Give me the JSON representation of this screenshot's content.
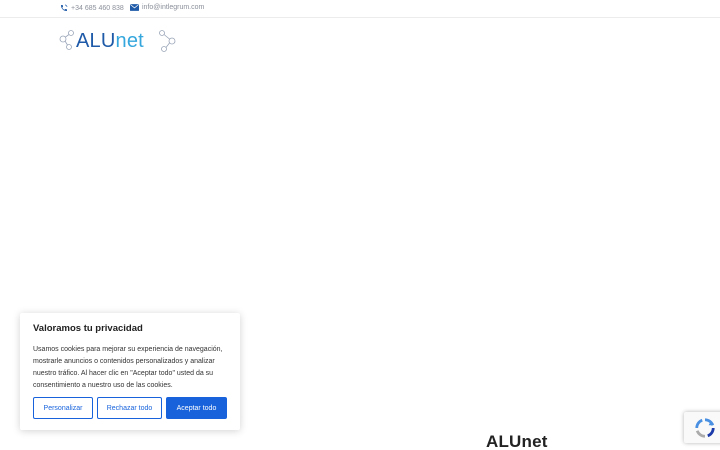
{
  "topbar": {
    "phone": "+34 685 460 838",
    "email": "info@intlegrum.com",
    "phone_icon": "phone-icon",
    "email_icon": "envelope-icon"
  },
  "logo": {
    "part1": "ALU",
    "part2": "net",
    "colors": {
      "alu": "#1e5aa8",
      "net": "#35a7dd"
    }
  },
  "cookie_banner": {
    "title": "Valoramos tu privacidad",
    "text": "Usamos cookies para mejorar su experiencia de navegación, mostrarle anuncios o contenidos personalizados y analizar nuestro tráfico. Al hacer clic en \"Aceptar todo\" usted da su consentimiento a nuestro uso de las cookies.",
    "customize_label": "Personalizar",
    "reject_label": "Rechazar todo",
    "accept_label": "Aceptar todo",
    "accent_color": "#1863dc"
  },
  "footer": {
    "title": "ALUnet"
  },
  "recaptcha": {
    "icon": "recaptcha-icon"
  }
}
